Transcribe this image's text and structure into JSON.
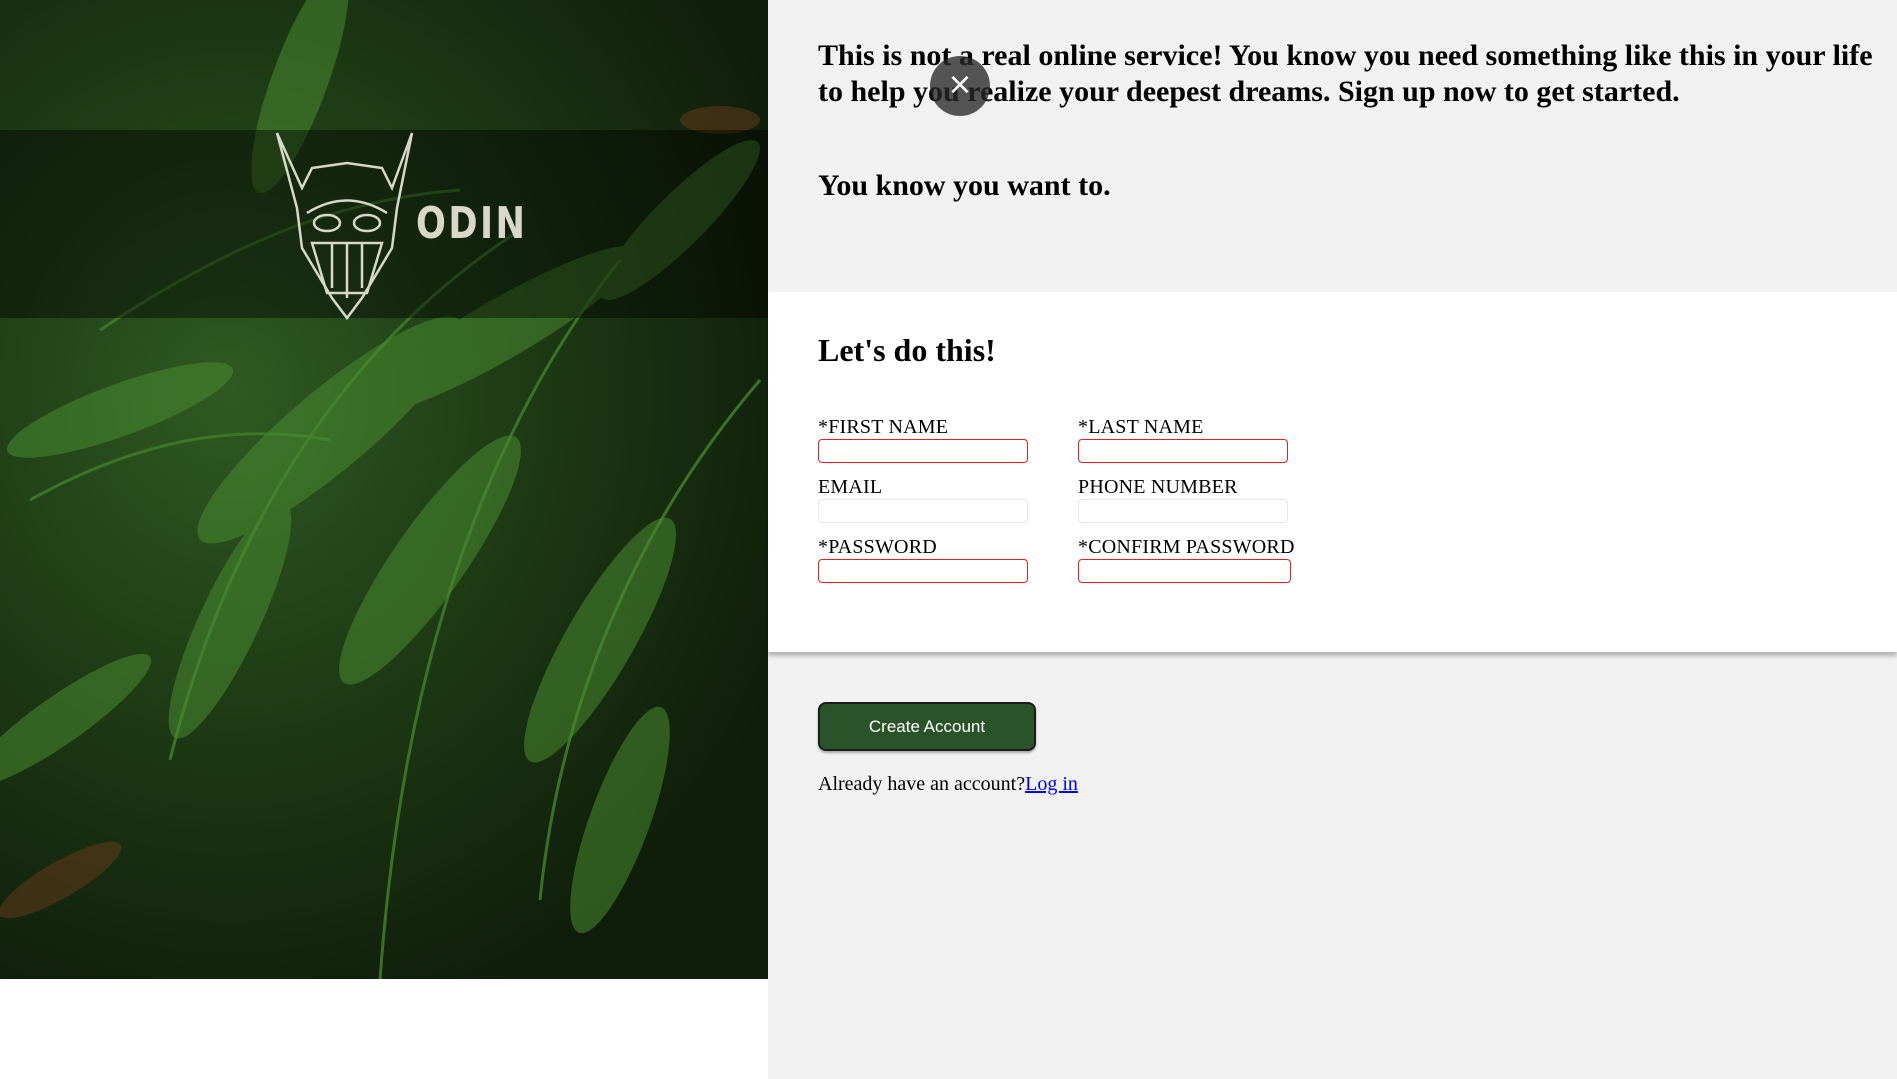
{
  "hero": {
    "logo_text": "ODIN",
    "logo_icon": "viking-helmet-icon"
  },
  "intro": {
    "text": "This is not a real online service! You know you need something like this in your life to help you realize your deepest dreams. Sign up now to get started.",
    "sub": "You know you want to."
  },
  "close_button": {
    "icon": "close-icon",
    "label": "×"
  },
  "form": {
    "title": "Let's do this!",
    "fields": {
      "first_name": {
        "label": "*FIRST NAME",
        "value": "",
        "required": true
      },
      "last_name": {
        "label": "*LAST NAME",
        "value": "",
        "required": true
      },
      "email": {
        "label": "EMAIL",
        "value": "",
        "required": false
      },
      "phone": {
        "label": "PHONE NUMBER",
        "value": "",
        "required": false
      },
      "password": {
        "label": "*PASSWORD",
        "value": "",
        "required": true
      },
      "confirm_password": {
        "label": "*CONFIRM PASSWORD",
        "value": "",
        "required": true
      }
    }
  },
  "actions": {
    "create_label": "Create Account",
    "login_prompt": "Already have an account?",
    "login_link": "Log in"
  },
  "colors": {
    "button_bg": "#2b5329",
    "required_border": "#e62020",
    "link": "#0000ee",
    "panel_bg": "#f1f1f1"
  }
}
